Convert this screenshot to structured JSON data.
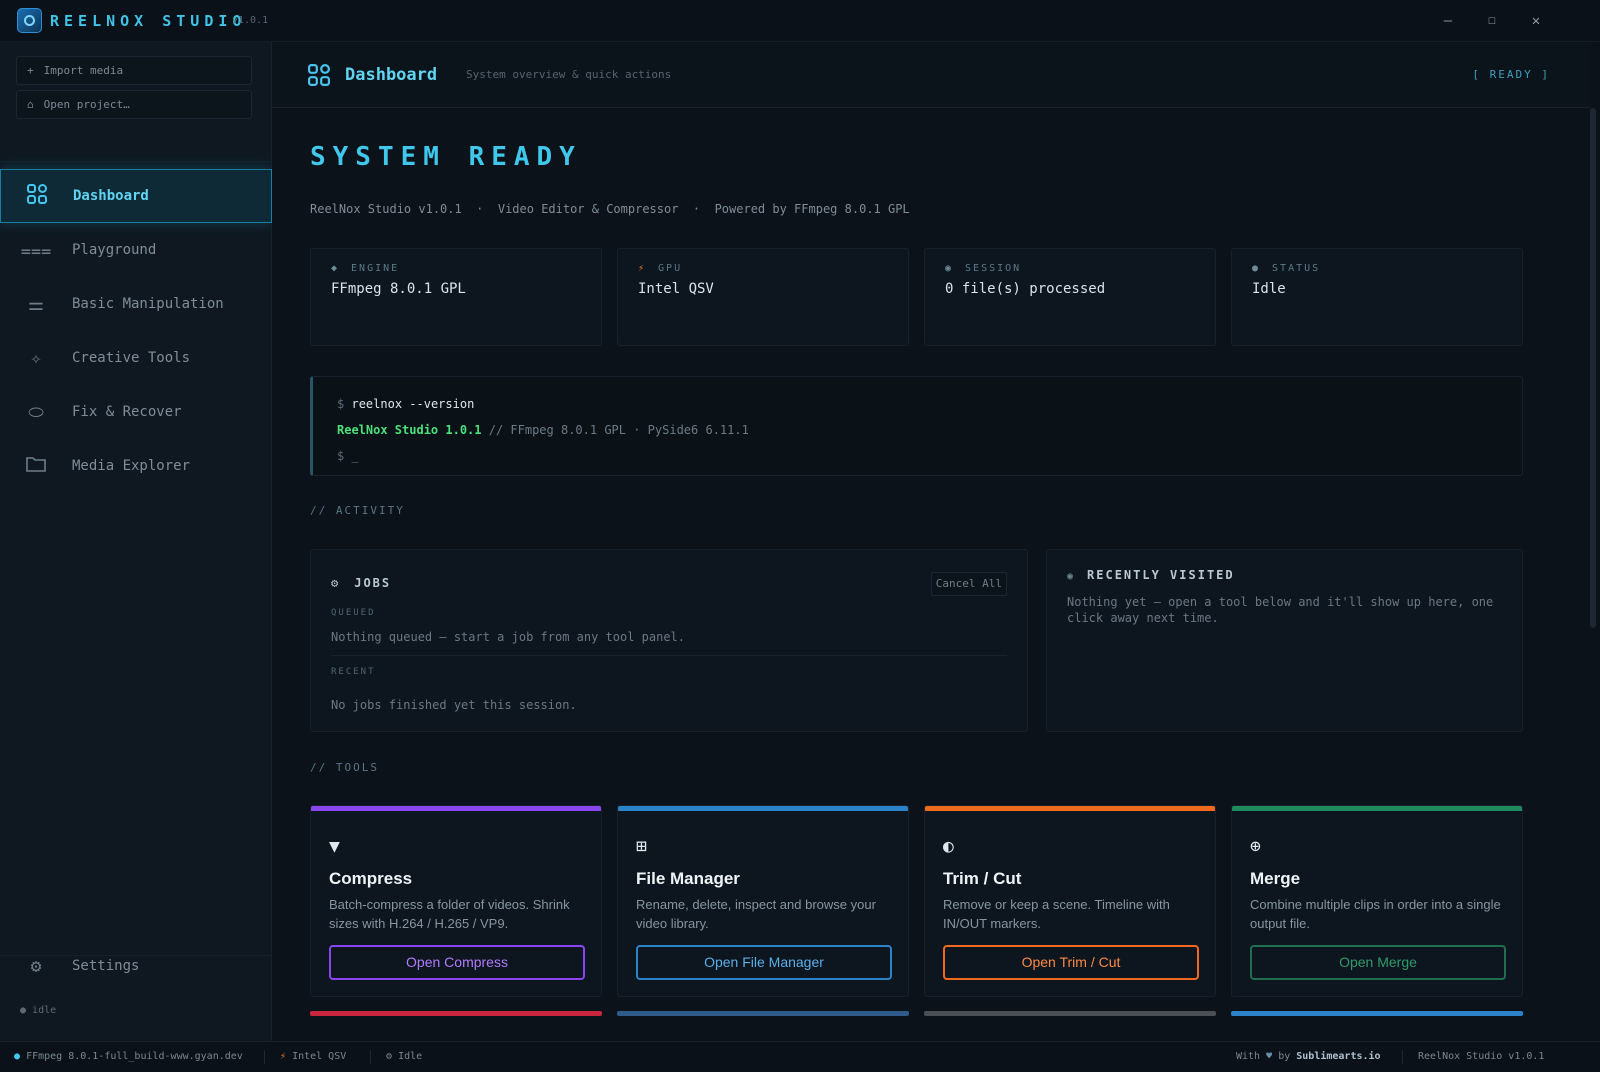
{
  "titlebar": {
    "title": "REELNOX STUDIO",
    "version": "v1.0.1",
    "controls": [
      "minimize-icon",
      "maximize-icon",
      "close-icon"
    ]
  },
  "sidebar": {
    "actions": [
      {
        "icon": "plus-icon",
        "label": "Import media"
      },
      {
        "icon": "folder-open-icon",
        "label": "Open project…"
      }
    ],
    "items": [
      {
        "icon": "grid-icon",
        "label": "Dashboard",
        "active": true
      },
      {
        "icon": "playground-icon",
        "label": "Playground"
      },
      {
        "icon": "sliders-icon",
        "label": "Basic Manipulation"
      },
      {
        "icon": "sparkle-icon",
        "label": "Creative Tools"
      },
      {
        "icon": "bandage-icon",
        "label": "Fix & Recover"
      },
      {
        "icon": "folder-icon",
        "label": "Media Explorer"
      }
    ],
    "settings_label": "Settings",
    "status": "idle"
  },
  "header": {
    "title": "Dashboard",
    "subtitle": "System overview & quick actions",
    "ready": "[ READY ]"
  },
  "hero": {
    "title": "SYSTEM READY",
    "line": "ReelNox Studio v1.0.1  ·  Video Editor & Compressor  ·  Powered by FFmpeg 8.0.1 GPL"
  },
  "stats": [
    {
      "glyph": "◆",
      "label": "ENGINE",
      "value": "FFmpeg 8.0.1 GPL",
      "color": "#8fb3c4"
    },
    {
      "glyph": "⚡",
      "label": "GPU",
      "value": "Intel QSV",
      "color": "#f07a2c"
    },
    {
      "glyph": "◉",
      "label": "SESSION",
      "value": "0 file(s) processed",
      "color": "#6f8b98"
    },
    {
      "glyph": "●",
      "label": "STATUS",
      "value": "Idle",
      "color": "#6f8b98"
    }
  ],
  "terminal": {
    "prompt": "$",
    "command": "reelnox --version",
    "output_main": "ReelNox Studio 1.0.1",
    "output_rest": "// FFmpeg 8.0.1 GPL · PySide6 6.11.1",
    "cursor": "_"
  },
  "activity": {
    "label": "// ACTIVITY",
    "jobs": {
      "title": "JOBS",
      "cancel_all": "Cancel All",
      "queued_label": "QUEUED",
      "queued_text": "Nothing queued — start a job from any tool panel.",
      "recent_label": "RECENT",
      "recent_text": "No jobs finished yet this session."
    },
    "recent": {
      "title": "RECENTLY VISITED",
      "text": "Nothing yet — open a tool below and it'll show up here, one click away next time."
    }
  },
  "tools": {
    "label": "// TOOLS",
    "items": [
      {
        "icon": "▼",
        "name": "Compress",
        "desc": "Batch-compress a folder of videos. Shrink sizes with H.264 / H.265 / VP9.",
        "button": "Open Compress",
        "color": "#8b45f0"
      },
      {
        "icon": "⊞",
        "name": "File Manager",
        "desc": "Rename, delete, inspect and browse your video library.",
        "button": "Open File Manager",
        "color": "#2a82c9"
      },
      {
        "icon": "◐",
        "name": "Trim / Cut",
        "desc": "Remove or keep a scene. Timeline with IN/OUT markers.",
        "button": "Open Trim / Cut",
        "color": "#f06a1e"
      },
      {
        "icon": "⊕",
        "name": "Merge",
        "desc": "Combine multiple clips in order into a single output file.",
        "button": "Open Merge",
        "color": "#1f8a5e"
      }
    ],
    "next_row_colors": [
      "#c8263e",
      "#2f5b8a",
      "#4a4f55",
      "#2a82c9"
    ]
  },
  "statusbar": {
    "ffmpeg": "FFmpeg 8.0.1-full_build-www.gyan.dev",
    "gpu": "Intel QSV",
    "state": "Idle",
    "credit_prefix": "With",
    "credit_by": "by",
    "credit_name": "Sublimearts.io",
    "version": "ReelNox Studio v1.0.1"
  }
}
